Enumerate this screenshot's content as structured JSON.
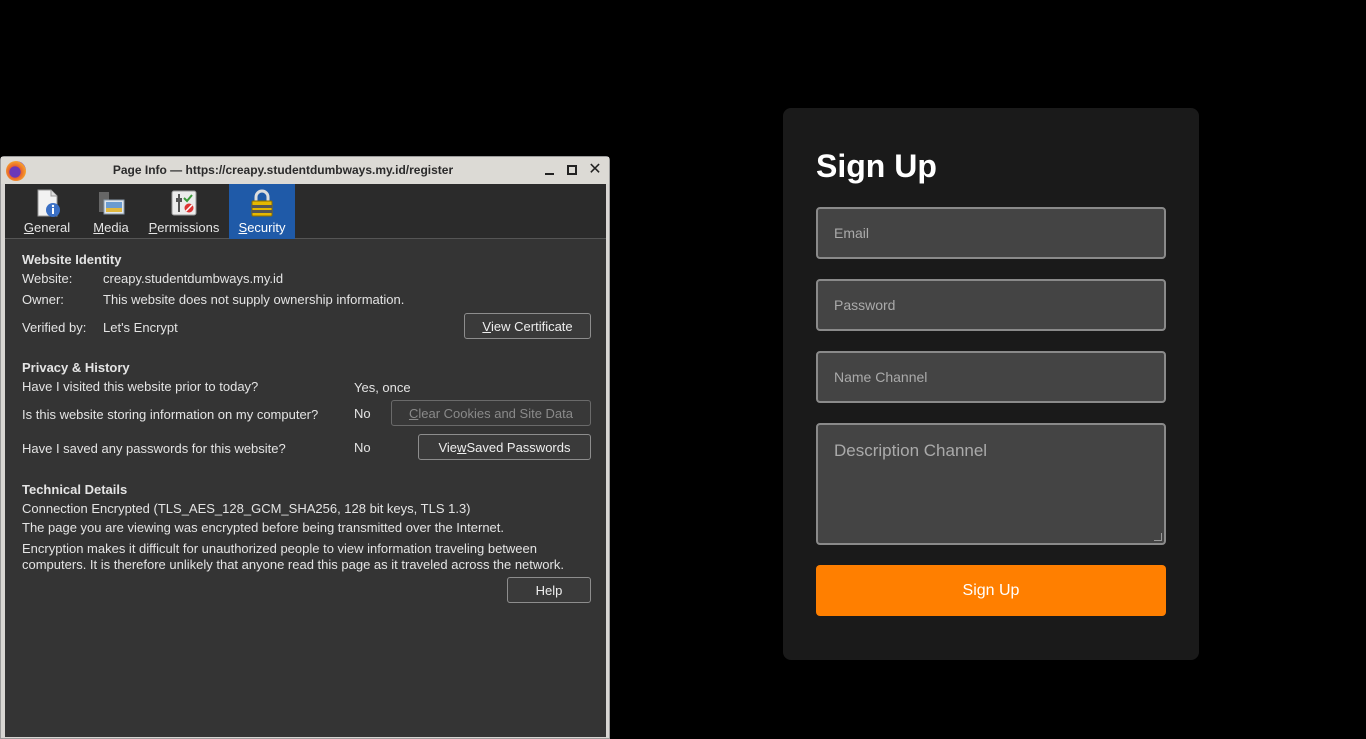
{
  "signup": {
    "title": "Sign Up",
    "email_placeholder": "Email",
    "password_placeholder": "Password",
    "channel_placeholder": "Name Channel",
    "description_placeholder": "Description Channel",
    "submit_label": "Sign Up",
    "accent_color": "#ff7f00"
  },
  "dialog": {
    "title": "Page Info — https://creapy.studentdumbways.my.id/register",
    "tabs": [
      {
        "pre": "",
        "key": "G",
        "post": "eneral"
      },
      {
        "pre": "",
        "key": "M",
        "post": "edia"
      },
      {
        "pre": "",
        "key": "P",
        "post": "ermissions"
      },
      {
        "pre": "",
        "key": "S",
        "post": "ecurity"
      }
    ],
    "identity": {
      "heading": "Website Identity",
      "website_label": "Website:",
      "website_value": "creapy.studentdumbways.my.id",
      "owner_label": "Owner:",
      "owner_value": "This website does not supply ownership information.",
      "verified_label": "Verified by:",
      "verified_value": "Let's Encrypt",
      "view_cert": {
        "key": "V",
        "rest": "iew Certificate"
      }
    },
    "privacy": {
      "heading": "Privacy & History",
      "q1": "Have I visited this website prior to today?",
      "a1": "Yes, once",
      "q2": "Is this website storing information on my computer?",
      "a2": "No",
      "clear_btn": {
        "key": "C",
        "rest": "lear Cookies and Site Data"
      },
      "q3": "Have I saved any passwords for this website?",
      "a3": "No",
      "saved_btn": {
        "pre": "Vie",
        "key": "w",
        "post": " Saved Passwords"
      }
    },
    "technical": {
      "heading": "Technical Details",
      "line1": "Connection Encrypted (TLS_AES_128_GCM_SHA256, 128 bit keys, TLS 1.3)",
      "line2": "The page you are viewing was encrypted before being transmitted over the Internet.",
      "line3": "Encryption makes it difficult for unauthorized people to view information traveling between",
      "line4": "computers. It is therefore unlikely that anyone read this page as it traveled across the network."
    },
    "help_label": "Help",
    "active_tab_color": "#1f5aa8"
  }
}
